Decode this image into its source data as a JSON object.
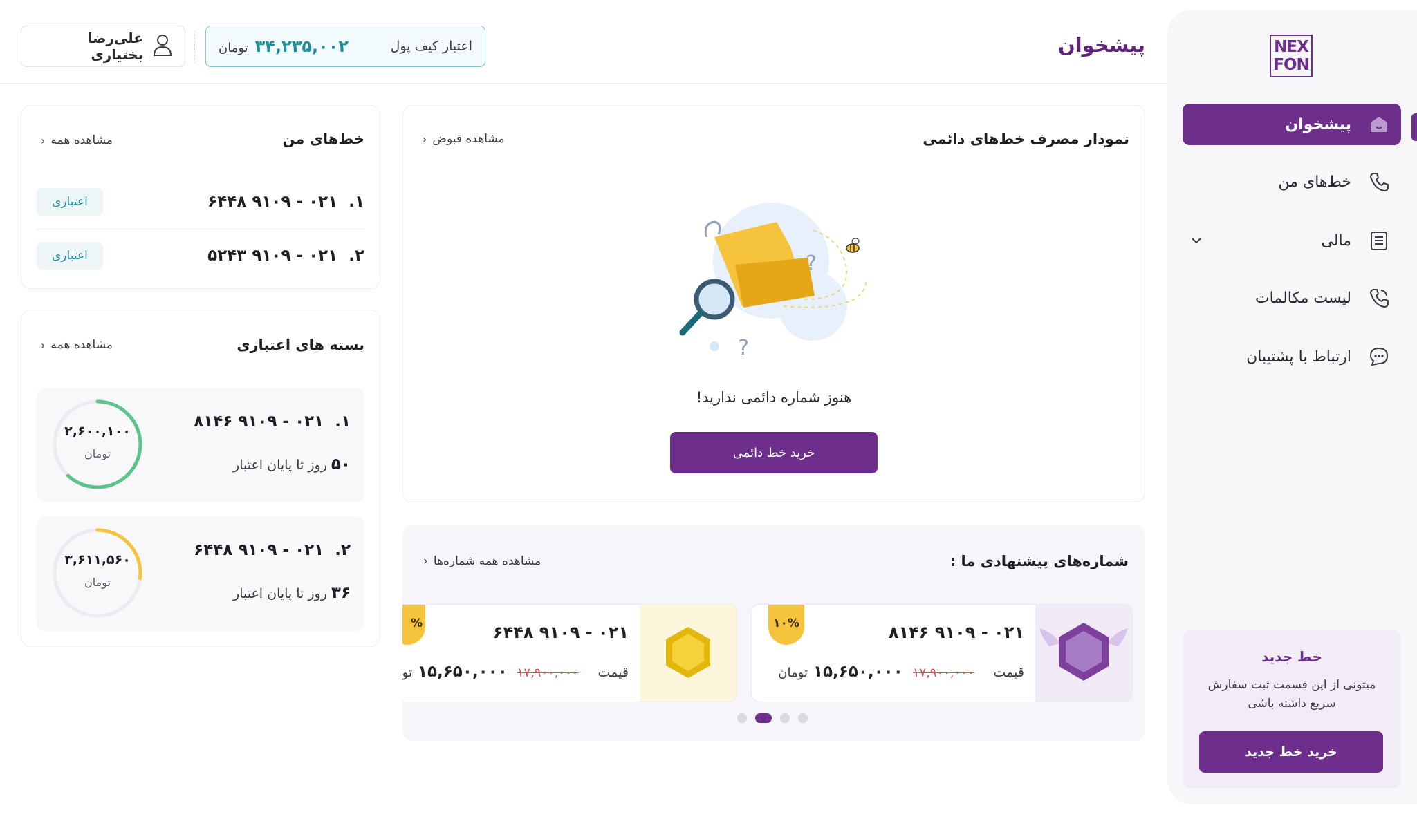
{
  "sidebar": {
    "logo": "NEX FON",
    "items": [
      {
        "label": "پیشخوان",
        "icon": "home-icon",
        "active": true
      },
      {
        "label": "خط‌های من",
        "icon": "phone-icon"
      },
      {
        "label": "مالی",
        "icon": "receipt-icon",
        "has_submenu": true
      },
      {
        "label": "لیست مکالمات",
        "icon": "call-log-icon"
      },
      {
        "label": "ارتباط با پشتیبان",
        "icon": "chat-support-icon"
      }
    ],
    "promo": {
      "title": "خط جدید",
      "text": "میتونی از این قسمت ثبت سفارش سریع داشته باشی",
      "button": "خرید خط جدید"
    }
  },
  "header": {
    "title": "پیشخوان",
    "wallet_label": "اعتبار کیف پول",
    "wallet_amount": "۳۴,۲۳۵,۰۰۲",
    "wallet_unit": "تومان",
    "user_name": "علی‌رضا بختیاری"
  },
  "usage_chart": {
    "title": "نمودار مصرف خط‌های دائمی",
    "link": "مشاهده قبوض",
    "empty_text": "هنوز شماره دائمی ندارید!",
    "button": "خرید خط دائمی"
  },
  "my_lines": {
    "title": "خط‌های من",
    "link": "مشاهده همه",
    "rows": [
      {
        "index": "۱.",
        "number": "۰۲۱ - ۹۱۰۹ ۶۴۴۸",
        "type": "اعتباری"
      },
      {
        "index": "۲.",
        "number": "۰۲۱ - ۹۱۰۹ ۵۲۴۳",
        "type": "اعتباری"
      }
    ]
  },
  "credit_packs": {
    "title": "بسته های اعتباری",
    "link": "مشاهده همه",
    "items": [
      {
        "index": "۱.",
        "number": "۰۲۱ - ۹۱۰۹ ۸۱۴۶",
        "days": "۵۰",
        "days_label": "روز تا پایان اعتبار",
        "amount": "۲,۶۰۰,۱۰۰",
        "unit": "تومان",
        "progress": 0.62,
        "color": "#5cc48a"
      },
      {
        "index": "۲.",
        "number": "۰۲۱ - ۹۱۰۹ ۶۴۴۸",
        "days": "۳۶",
        "days_label": "روز تا پایان اعتبار",
        "amount": "۳,۶۱۱,۵۶۰",
        "unit": "تومان",
        "progress": 0.27,
        "color": "#f5c43c"
      }
    ]
  },
  "offers": {
    "title": "شماره‌های پیشنهادی ما :",
    "link": "مشاهده همه شماره‌ها",
    "items": [
      {
        "number": "۰۲۱ - ۹۱۰۹ ۸۱۴۶",
        "price_label": "قیمت",
        "old_price": "۱۷,۹۰۰,۰۰۰",
        "new_price": "۱۵,۶۵۰,۰۰۰",
        "unit": "تومان",
        "discount": "۱۰%",
        "badge": "purple-hexagon-badge-icon"
      },
      {
        "number": "۰۲۱ - ۹۱۰۹ ۶۴۴۸",
        "price_label": "قیمت",
        "old_price": "۱۷,۹۰۰,۰۰۰",
        "new_price": "۱۵,۶۵۰,۰۰۰",
        "unit": "تو",
        "discount": "%",
        "badge": "gold-hexagon-badge-icon"
      }
    ],
    "dots": 4,
    "active_dot": 2
  },
  "colors": {
    "brand": "#6e2f8c",
    "teal": "#1f8f9c",
    "danger": "#e0505a",
    "gold": "#f5c43c"
  }
}
